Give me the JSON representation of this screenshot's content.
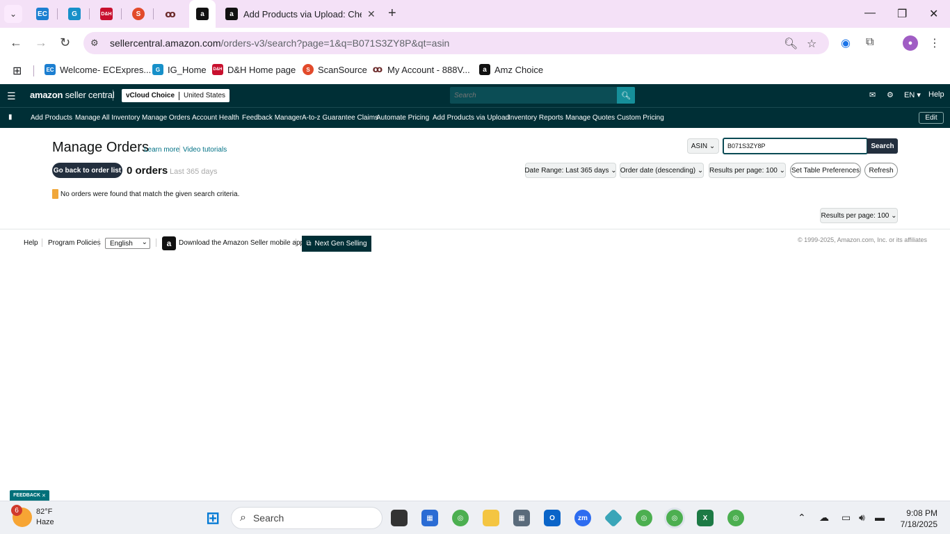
{
  "browser": {
    "active_tab_title": "Add Products via Upload: Chec",
    "url_host": "sellercentral.amazon.com",
    "url_path": "/orders-v3/search?page=1&q=B071S3ZY8P&qt=asin",
    "bookmarks": [
      {
        "label": "Welcome- ECExpres..."
      },
      {
        "label": "IG_Home"
      },
      {
        "label": "D&H Home page"
      },
      {
        "label": "ScanSource"
      },
      {
        "label": "My Account - 888V..."
      },
      {
        "label": "Amz Choice"
      }
    ]
  },
  "header": {
    "logo_main": "amazon",
    "logo_sub": " seller central",
    "store_name": "vCloud Choice",
    "store_region": "United States",
    "search_placeholder": "Search",
    "lang": "EN",
    "help": "Help"
  },
  "nav": {
    "items": [
      "Add Products",
      "Manage All Inventory",
      "Manage Orders",
      "Account Health",
      "Feedback Manager",
      "A-to-z Guarantee Claims",
      "Automate Pricing",
      "Add Products via Upload",
      "Inventory Reports",
      "Manage Quotes",
      "Custom Pricing"
    ],
    "edit": "Edit"
  },
  "main": {
    "title": "Manage Orders",
    "learn_more": "Learn more",
    "video_tutorials": "Video tutorials",
    "search_type": "ASIN",
    "search_value": "B071S3ZY8P",
    "search_button": "Search",
    "back_button": "Go back to order list",
    "orders_count": "0 orders",
    "orders_range": "Last 365 days",
    "date_range": "Date Range: Last 365 days",
    "sort": "Order date (descending)",
    "results_per_page": "Results per page: 100",
    "table_prefs": "Set Table Preferences",
    "refresh": "Refresh",
    "no_orders_message": "No orders were found that match the given search criteria.",
    "results_per_page_bottom": "Results per page: 100"
  },
  "footer": {
    "help": "Help",
    "program_policies": "Program Policies",
    "language": "English",
    "download_app": "Download the Amazon Seller mobile app",
    "next_gen": "Next Gen Selling",
    "copyright": "© 1999-2025, Amazon.com, Inc. or its affiliates"
  },
  "feedback": "FEEDBACK",
  "taskbar": {
    "weather_alerts": "6",
    "temperature": "82°F",
    "condition": "Haze",
    "search_label": "Search",
    "time": "9:08 PM",
    "date": "7/18/2025"
  }
}
